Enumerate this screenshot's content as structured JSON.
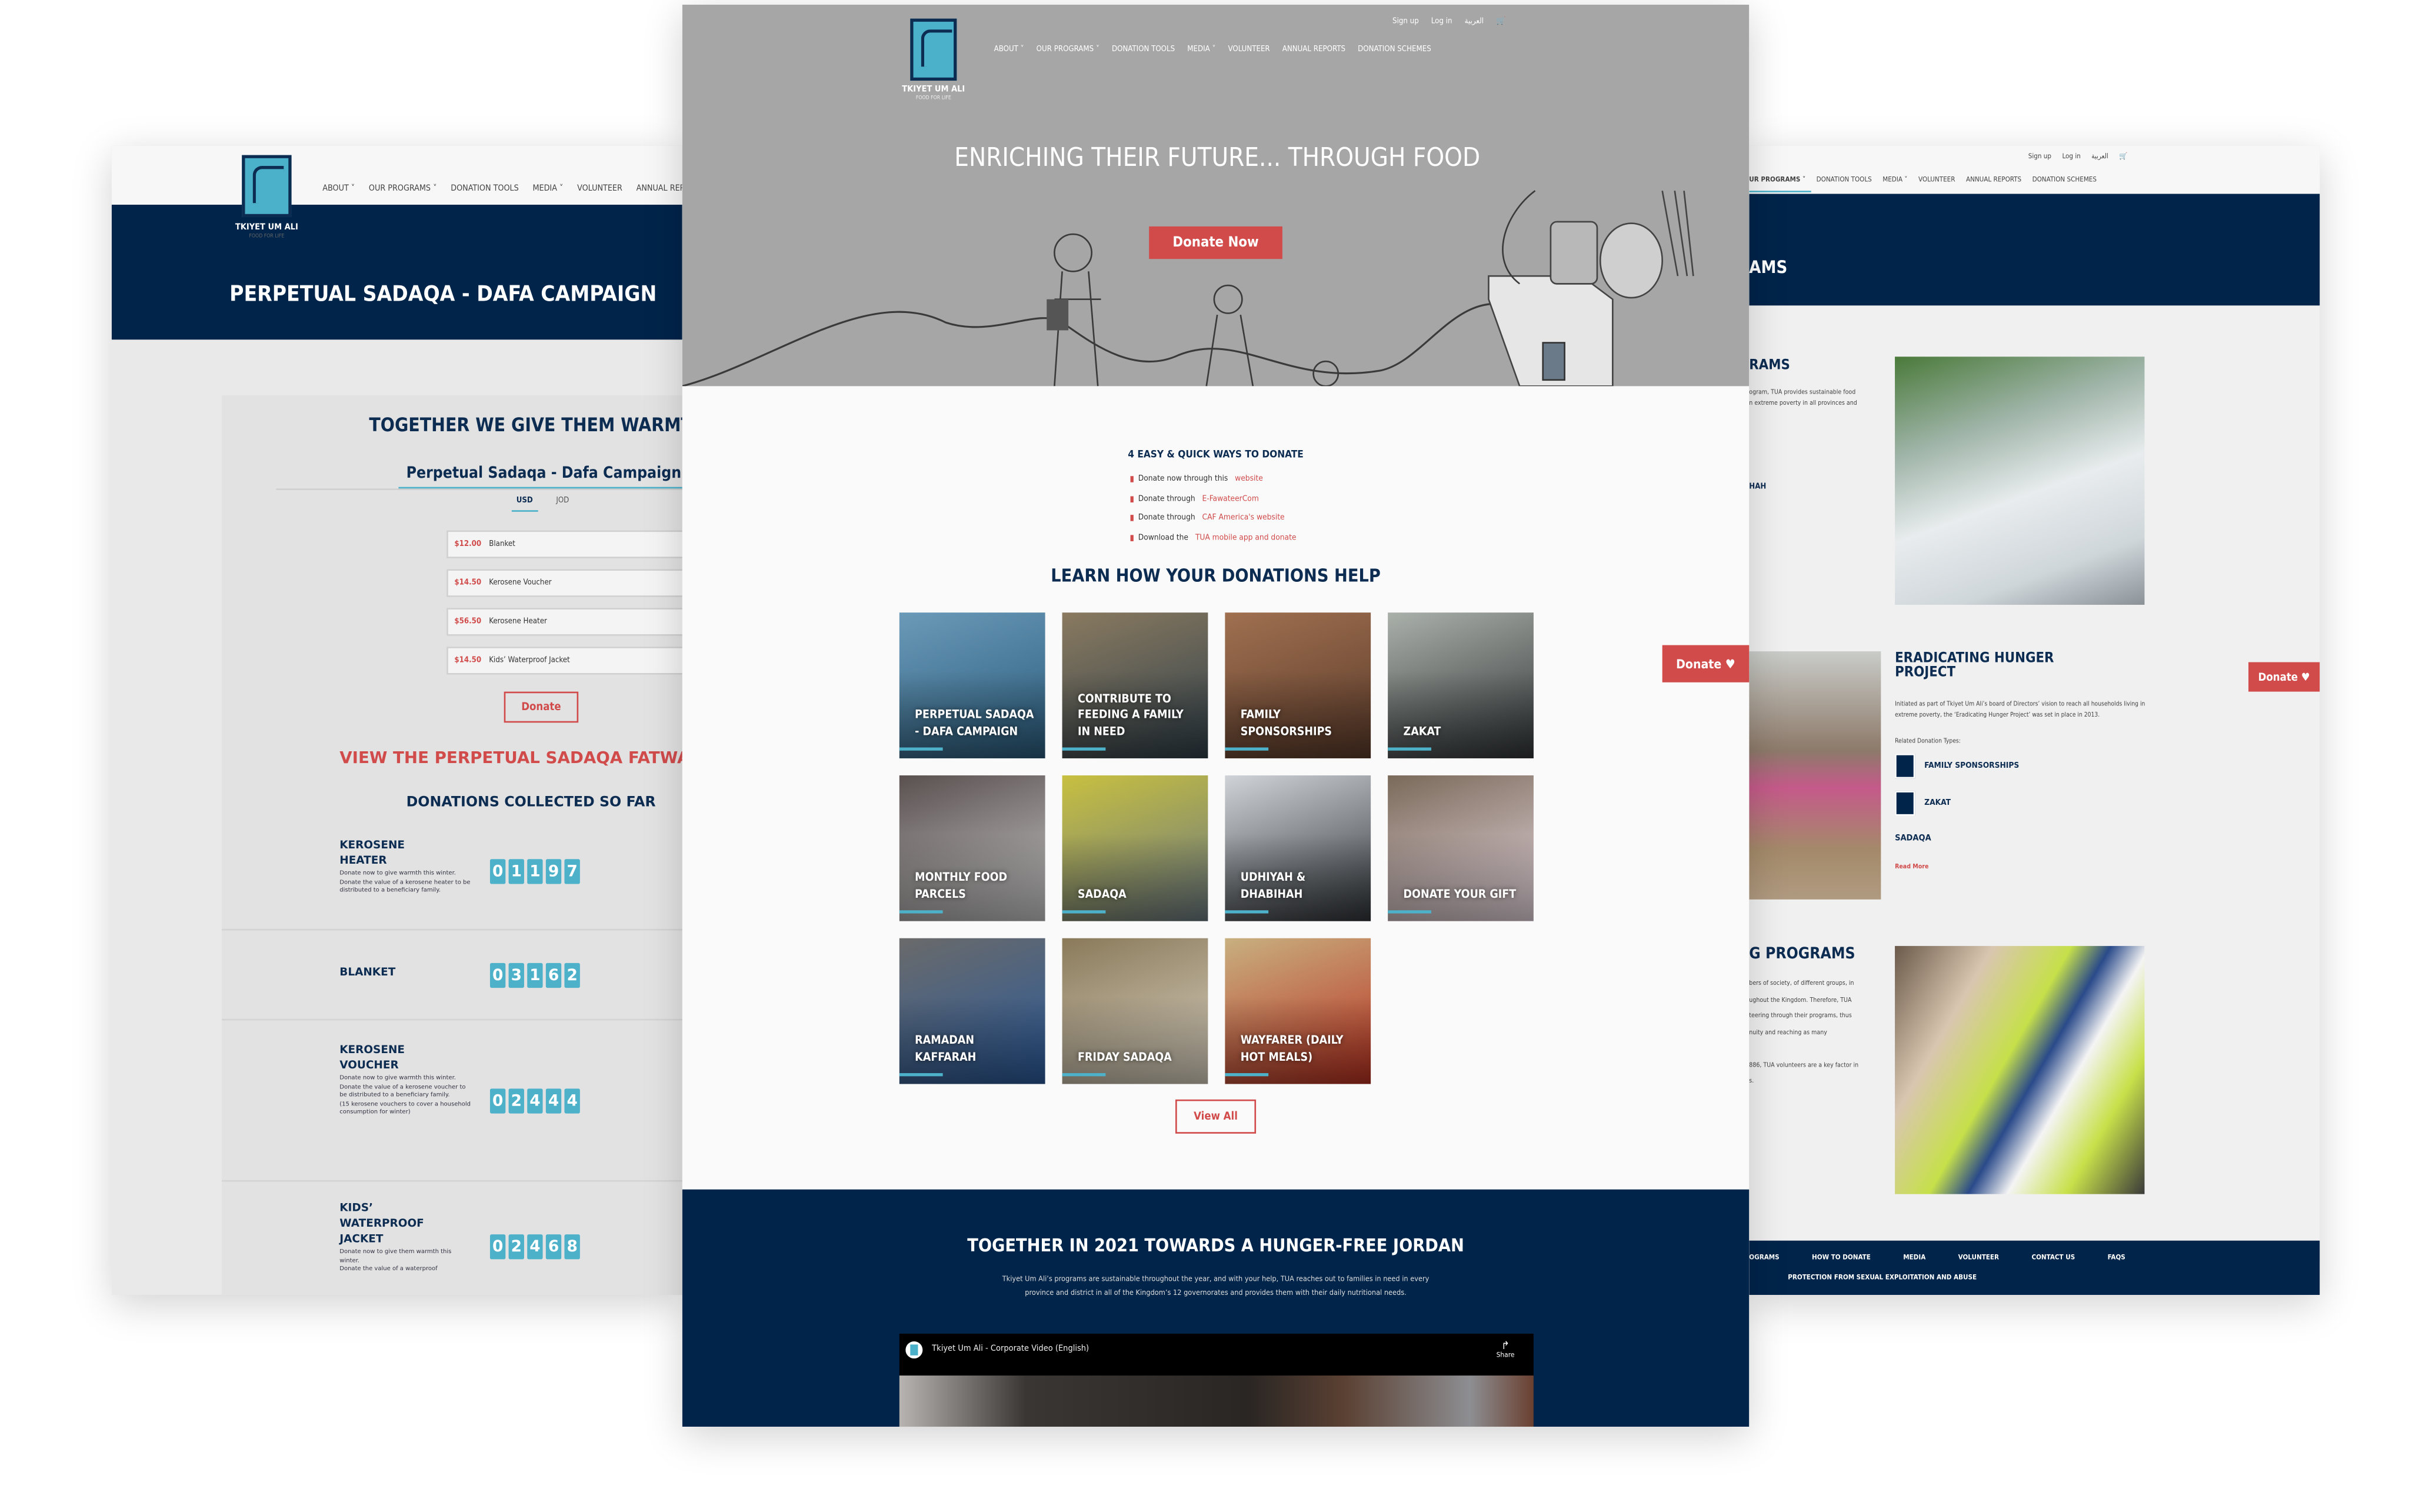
{
  "brand": {
    "name": "TKIYET UM ALI",
    "tagline": "FOOD FOR LIFE"
  },
  "colors": {
    "navy": "#00244a",
    "accent": "#4db1ca",
    "red": "#d14b4b",
    "hero_gray": "#a6a6a6"
  },
  "top_links": [
    "Sign up",
    "Log in",
    "العربية"
  ],
  "nav": [
    "ABOUT ˅",
    "OUR PROGRAMS ˅",
    "DONATION TOOLS",
    "MEDIA ˅",
    "VOLUNTEER",
    "ANNUAL REPORTS",
    "DONATION SCHEMES"
  ],
  "left": {
    "page_title": "PERPETUAL SADAQA - DAFA CAMPAIGN",
    "heading": "TOGETHER WE GIVE THEM WARMTH",
    "form_title": "Perpetual Sadaqa - Dafa Campaign",
    "currencies": [
      "USD",
      "JOD"
    ],
    "selected_currency": "USD",
    "items": [
      {
        "price": "$12.00",
        "name": "Blanket",
        "qty": "-"
      },
      {
        "price": "$14.50",
        "name": "Kerosene Voucher",
        "qty": "-"
      },
      {
        "price": "$56.50",
        "name": "Kerosene Heater",
        "qty": "-"
      },
      {
        "price": "$14.50",
        "name": "Kids’ Waterproof Jacket",
        "qty": "-"
      }
    ],
    "donate_label": "Donate",
    "fatwa_link": "VIEW THE PERPETUAL SADAQA FATWA",
    "collected_heading": "DONATIONS COLLECTED SO FAR",
    "counters": [
      {
        "title": "KEROSENE HEATER",
        "desc": [
          "Donate now to give warmth this winter.",
          "Donate the value of a kerosene heater to be distributed to a beneficiary family."
        ],
        "value": "01197"
      },
      {
        "title": "BLANKET",
        "desc": [],
        "value": "03162"
      },
      {
        "title": "KEROSENE VOUCHER",
        "desc": [
          "Donate now to give warmth this winter.",
          "Donate the value of a kerosene voucher to be distributed to a beneficiary family.",
          "(15 kerosene vouchers to cover a household consumption for winter)"
        ],
        "value": "02444"
      },
      {
        "title": "KIDS’ WATERPROOF JACKET",
        "desc": [
          "Donate now to give them warmth this winter.",
          "Donate the value of a waterproof"
        ],
        "value": "02468"
      }
    ]
  },
  "center": {
    "hero_title": "ENRICHING THEIR FUTURE... THROUGH FOOD",
    "hero_button": "Donate Now",
    "ways_heading": "4 EASY & QUICK WAYS TO DONATE",
    "ways": [
      {
        "text": "Donate now through this ",
        "link": "website"
      },
      {
        "text": "Donate through ",
        "link": "E-FawateerCom"
      },
      {
        "text": "Donate through ",
        "link": "CAF America's website"
      },
      {
        "text": "Download the ",
        "link": "TUA mobile app and donate"
      }
    ],
    "learn_heading": "LEARN HOW YOUR DONATIONS HELP",
    "tiles": [
      "PERPETUAL SADAQA - DAFA CAMPAIGN",
      "CONTRIBUTE TO FEEDING A FAMILY IN NEED",
      "FAMILY SPONSORSHIPS",
      "ZAKAT",
      "MONTHLY FOOD PARCELS",
      "SADAQA",
      "UDHIYAH & DHABIHAH",
      "DONATE YOUR GIFT",
      "RAMADAN KAFFARAH",
      "FRIDAY SADAQA",
      "WAYFARER (DAILY HOT MEALS)"
    ],
    "view_all": "View All",
    "floating_donate": "Donate ♥",
    "bottom_heading": "TOGETHER IN 2021 TOWARDS A HUNGER-FREE JORDAN",
    "bottom_text": "Tkiyet Um Ali’s programs are sustainable throughout the year, and with your help, TUA reaches out to families in need in every province and district in all of the Kingdom’s 12 governorates and provides them with their daily nutritional needs.",
    "video_title": "Tkiyet Um Ali - Corporate Video (English)",
    "video_share": "Share"
  },
  "right": {
    "nav": [
      "UR PROGRAMS ˅",
      "DONATION TOOLS",
      "MEDIA ˅",
      "VOLUNTEER",
      "ANNUAL REPORTS",
      "DONATION SCHEMES"
    ],
    "page_title": "AMS",
    "sec1_title": "RAMS",
    "sec1_text": [
      "ogram, TUA provides sustainable food",
      "n extreme poverty in all provinces and"
    ],
    "sec1_sub": "HAH",
    "sec2_title": "ERADICATING HUNGER PROJECT",
    "sec2_text": "Initiated as part of Tkiyet Um Ali’s board of Directors’ vision to reach all households living in extreme poverty, the ‘Eradicating Hunger Project’ was set in place in 2013.",
    "related_label": "Related Donation Types:",
    "related": [
      "FAMILY SPONSORSHIPS",
      "ZAKAT"
    ],
    "sadaqa": "SADAQA",
    "read_more": "Read More",
    "donate_tab": "Donate ♥",
    "sec3_title": "G PROGRAMS",
    "sec3_text": [
      "bers of society, of different groups, in",
      "ughout the Kingdom. Therefore, TUA",
      "teering through their programs, thus",
      "nuity and reaching as many",
      "",
      "886, TUA volunteers are a key factor in",
      "s."
    ],
    "footer_links": [
      "OGRAMS",
      "HOW TO DONATE",
      "MEDIA",
      "VOLUNTEER",
      "CONTACT US",
      "FAQS"
    ],
    "footer_link2": "PROTECTION FROM SEXUAL EXPLOITATION AND ABUSE"
  }
}
